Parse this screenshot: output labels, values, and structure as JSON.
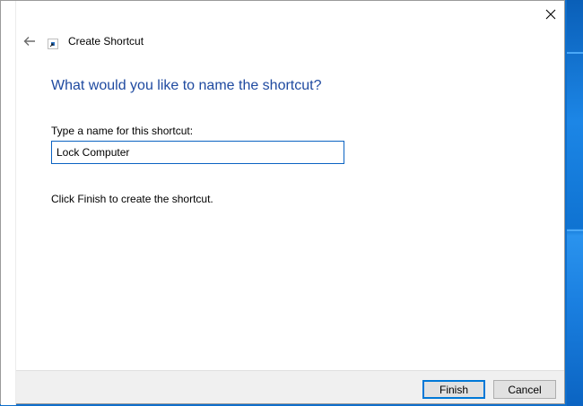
{
  "window": {
    "title": "Create Shortcut",
    "close_glyph": "✕",
    "back_glyph": "←"
  },
  "content": {
    "heading": "What would you like to name the shortcut?",
    "field_label": "Type a name for this shortcut:",
    "name_value": "Lock Computer",
    "hint": "Click Finish to create the shortcut."
  },
  "footer": {
    "finish_label": "Finish",
    "cancel_label": "Cancel"
  },
  "icons": {
    "back": "back-arrow-icon",
    "close": "close-icon",
    "title": "shortcut-icon"
  },
  "colors": {
    "heading": "#1f4aa0",
    "accent": "#0078d7",
    "desktop": "#0f6fcc",
    "footer": "#f0f0f0"
  }
}
